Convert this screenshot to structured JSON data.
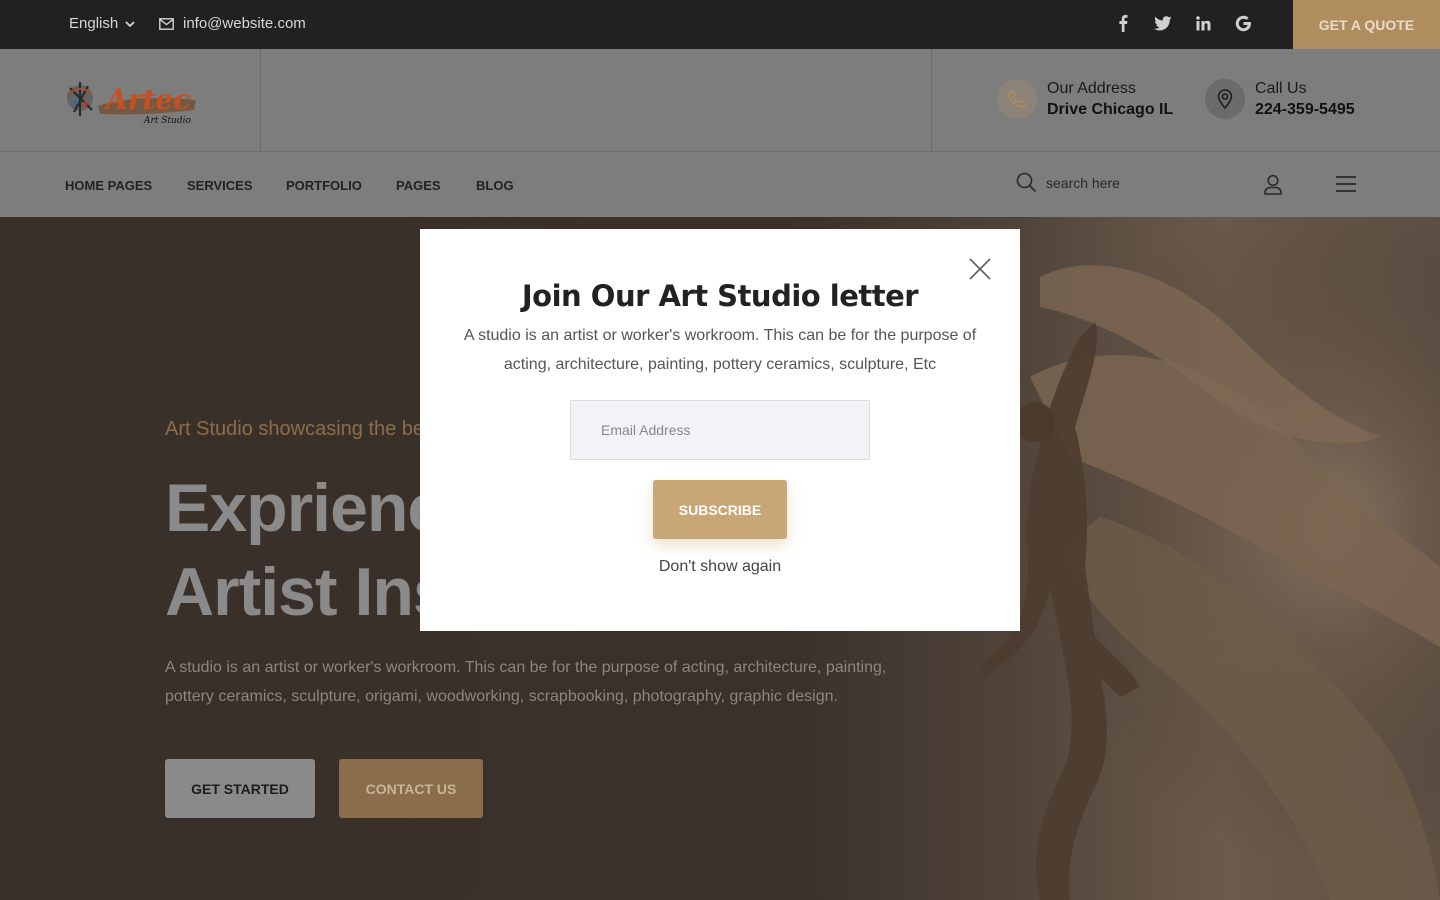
{
  "topbar": {
    "language": "English",
    "email": "info@website.com",
    "socials": [
      "facebook-icon",
      "twitter-icon",
      "linkedin-icon",
      "google-icon"
    ],
    "quote_label": "GET A QUOTE"
  },
  "header": {
    "logo_text": "Artec",
    "logo_subtext": "Art Studio",
    "address": {
      "label": "Our Address",
      "value": "Drive Chicago IL"
    },
    "call": {
      "label": "Call Us",
      "value": "224-359-5495"
    }
  },
  "nav": {
    "items": [
      "HOME PAGES",
      "SERVICES",
      "PORTFOLIO",
      "PAGES",
      "BLOG"
    ],
    "search_placeholder": "search here"
  },
  "hero": {
    "tagline": "Art Studio showcasing the bes",
    "heading_line1": "Exprienc",
    "heading_line2": "Artist Ins",
    "description": "A studio is an artist or worker's workroom. This can be for the purpose of acting, architecture, painting, pottery ceramics, sculpture, origami, woodworking, scrapbooking, photography, graphic design.",
    "btn_start": "GET STARTED",
    "btn_contact": "CONTACT US"
  },
  "modal": {
    "title": "Join Our Art Studio letter",
    "description": "A studio is an artist or worker's workroom. This can be for the purpose of acting, architecture, painting, pottery ceramics, sculpture, Etc",
    "email_placeholder": "Email Address",
    "subscribe_label": "SUBSCRIBE",
    "dont_show_label": "Don't show again"
  },
  "colors": {
    "accent": "#c9a676",
    "topbar_bg": "#212121",
    "overlay_header": "#7d7d7d"
  }
}
